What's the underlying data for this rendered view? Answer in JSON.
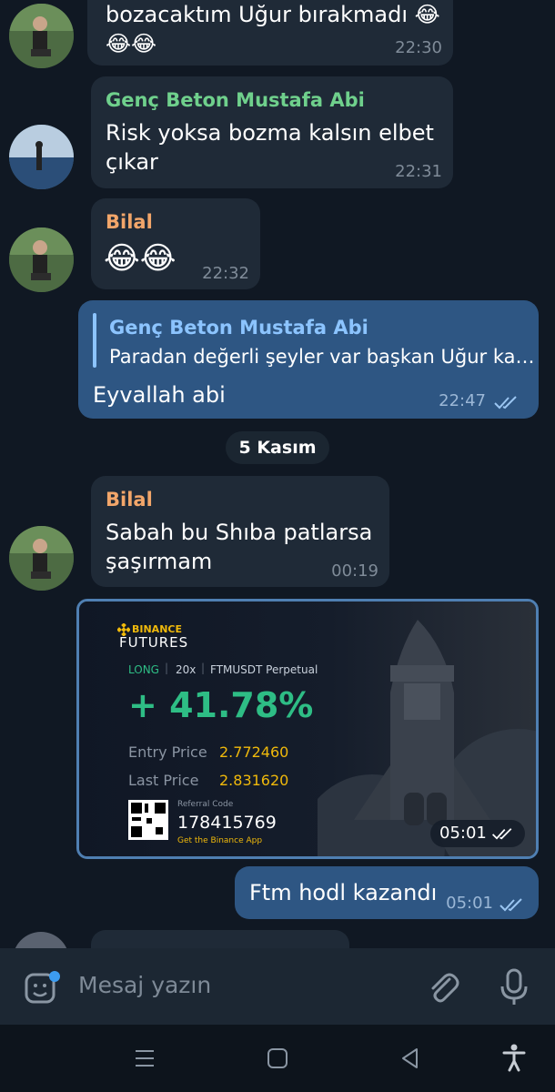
{
  "messages": [
    {
      "id": "m1",
      "text_line1": "bozacaktım Uğur bırakmadı 😂",
      "text_line2": "😂😂",
      "time": "22:30"
    },
    {
      "id": "m2",
      "sender": "Genç Beton Mustafa Abi",
      "text_line1": "Risk yoksa bozma kalsın elbet",
      "text_line2": "çıkar",
      "time": "22:31"
    },
    {
      "id": "m3",
      "sender": "Bilal",
      "text": "😂😂",
      "time": "22:32"
    },
    {
      "id": "m4",
      "reply_sender": "Genç Beton Mustafa Abi",
      "reply_text": "Paradan değerli şeyler var başkan Uğur ka…",
      "text": "Eyvallah abi",
      "time": "22:47"
    },
    {
      "id": "m5",
      "sender": "Bilal",
      "text_line1": "Sabah bu Shıba patlarsa",
      "text_line2": "şaşırmam",
      "time": "00:19"
    },
    {
      "id": "m6",
      "time": "05:01"
    },
    {
      "id": "m7",
      "text": "Ftm hodl kazandı",
      "time": "05:01"
    }
  ],
  "date_separator": "5 Kasım",
  "binance_card": {
    "brand_top": "BINANCE",
    "brand_bottom": "FUTURES",
    "side": "LONG",
    "leverage": "20x",
    "pair": "FTMUSDT Perpetual",
    "pnl": "+ 41.78%",
    "entry_label": "Entry Price",
    "entry_value": "2.772460",
    "last_label": "Last Price",
    "last_value": "2.831620",
    "referral_label": "Referral Code",
    "referral_code": "178415769",
    "app_text": "Get the Binance App"
  },
  "input": {
    "placeholder": "Mesaj yazın"
  },
  "colors": {
    "sender_green": "#6fd08c",
    "sender_orange": "#f2a66a",
    "reply_blue": "#8cc4ff",
    "outgoing_bubble": "#2e5683",
    "incoming_bubble": "#1f2a37"
  }
}
